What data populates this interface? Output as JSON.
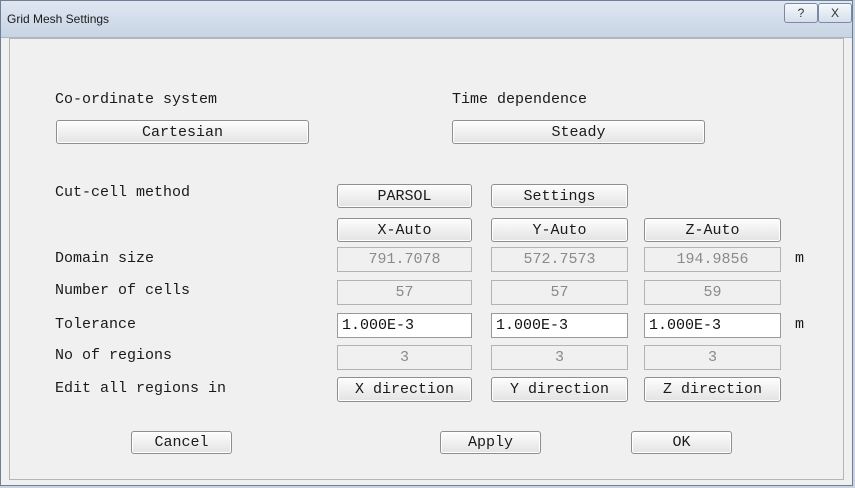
{
  "window": {
    "title": "Grid Mesh Settings",
    "help_label": "?",
    "close_label": "X"
  },
  "coord": {
    "label": "Co-ordinate system",
    "value": "Cartesian"
  },
  "time": {
    "label": "Time dependence",
    "value": "Steady"
  },
  "cutcell": {
    "label": "Cut-cell method",
    "method": "PARSOL",
    "settings": "Settings"
  },
  "auto": {
    "x": "X-Auto",
    "y": "Y-Auto",
    "z": "Z-Auto"
  },
  "rows": {
    "domain_size": {
      "label": "Domain size",
      "x": "791.7078",
      "y": "572.7573",
      "z": "194.9856",
      "unit": "m"
    },
    "num_cells": {
      "label": "Number of cells",
      "x": "57",
      "y": "57",
      "z": "59"
    },
    "tolerance": {
      "label": "Tolerance",
      "x": "1.000E-3",
      "y": "1.000E-3",
      "z": "1.000E-3",
      "unit": "m"
    },
    "num_regions": {
      "label": "No of regions",
      "x": "3",
      "y": "3",
      "z": "3"
    },
    "edit_regions": {
      "label": "Edit all regions in",
      "x": "X direction",
      "y": "Y direction",
      "z": "Z direction"
    }
  },
  "footer": {
    "cancel": "Cancel",
    "apply": "Apply",
    "ok": "OK"
  }
}
